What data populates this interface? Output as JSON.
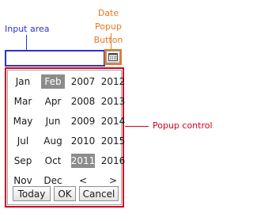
{
  "annotations": {
    "input_area": "Input area",
    "date_popup_button_line1": "Date Popup",
    "date_popup_button_line2": "Button",
    "popup_control": "Popup control"
  },
  "input": {
    "value": ""
  },
  "date_button": {
    "icon": "calendar-icon"
  },
  "popup": {
    "months": [
      "Jan",
      "Feb",
      "Mar",
      "Apr",
      "May",
      "Jun",
      "Jul",
      "Aug",
      "Sep",
      "Oct",
      "Nov",
      "Dec"
    ],
    "years": [
      "2007",
      "2012",
      "2008",
      "2013",
      "2009",
      "2014",
      "2010",
      "2015",
      "2011",
      "2016"
    ],
    "selected_month": "Feb",
    "selected_year": "2011",
    "prev_label": "<",
    "next_label": ">",
    "buttons": {
      "today": "Today",
      "ok": "OK",
      "cancel": "Cancel"
    }
  },
  "colors": {
    "input_annotation": "#2c33c8",
    "button_annotation": "#e87722",
    "popup_annotation": "#d6001c",
    "selected_cell": "#8c8c8c"
  }
}
